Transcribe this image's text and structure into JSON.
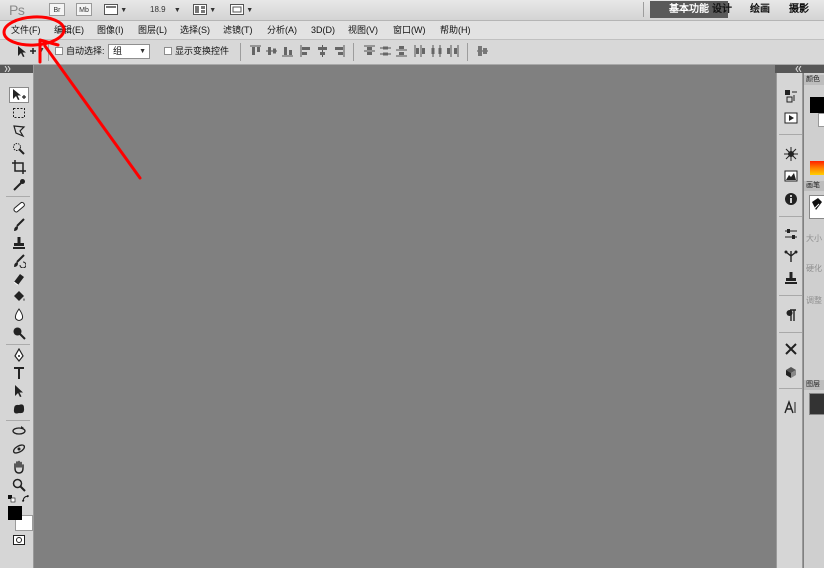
{
  "app": {
    "logo": "Ps",
    "bridge_label": "Br",
    "minibridge_label": "Mb",
    "zoom": "18.9",
    "workspaces": {
      "active": "基本功能",
      "design": "设计",
      "painting": "绘画",
      "photography": "摄影"
    }
  },
  "menu": {
    "items": [
      "文件(F)",
      "编辑(E)",
      "图像(I)",
      "图层(L)",
      "选择(S)",
      "滤镜(T)",
      "分析(A)",
      "3D(D)",
      "视图(V)",
      "窗口(W)",
      "帮助(H)"
    ]
  },
  "options": {
    "auto_select_label": "自动选择:",
    "auto_select_value": "组",
    "show_transform_label": "显示变换控件"
  },
  "right_panel": {
    "tab_color": "颜色",
    "tab_brush": "画笔",
    "row_size": "大小",
    "row_hardness": "硬化",
    "row_adjust": "调整",
    "tab_layers": "图层"
  },
  "colors": {
    "canvas": "#808080",
    "annotation": "#ff0000",
    "active_workspace": "#5a5a5a"
  },
  "annotation": {
    "target": "文件(F)",
    "shape": "red-circle-with-arrow"
  }
}
